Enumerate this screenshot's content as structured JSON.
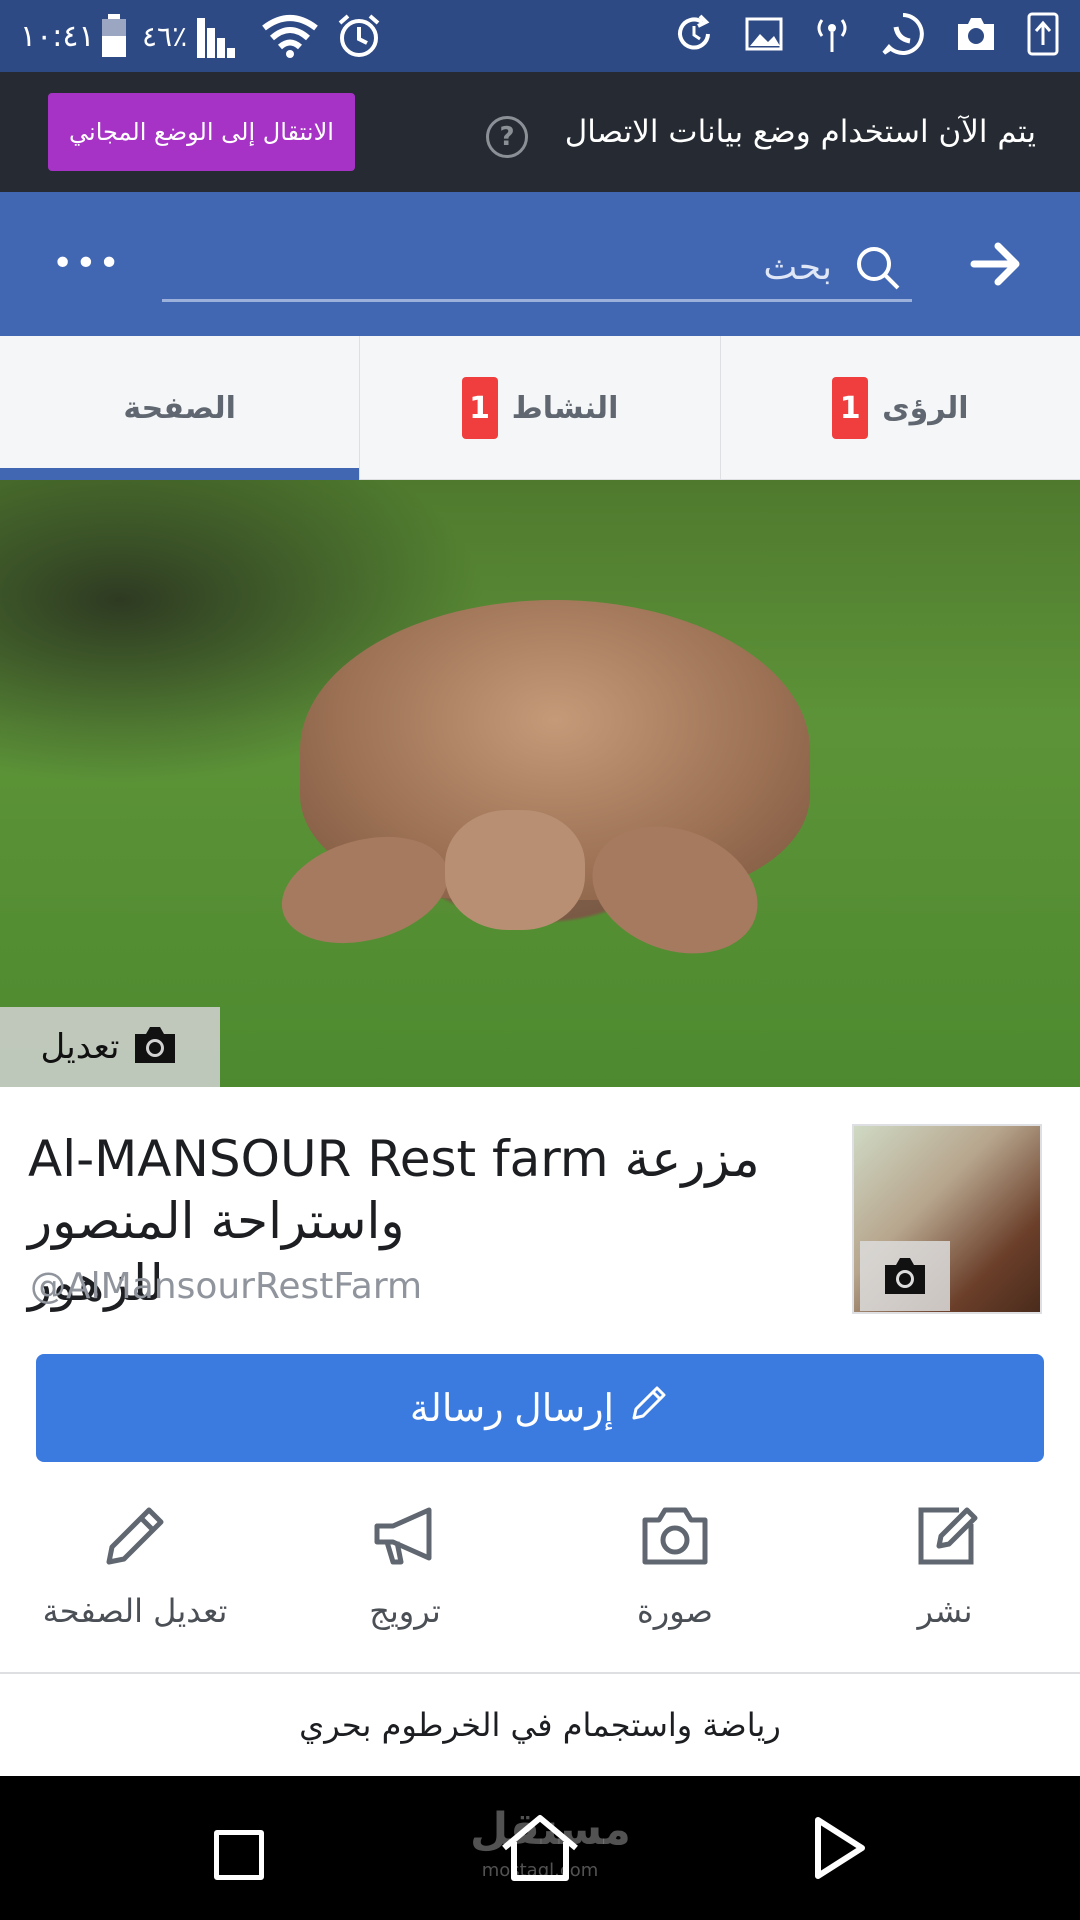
{
  "status_bar": {
    "time": "١٠:٤١",
    "battery_percent": "٤٦٪",
    "icons": [
      "battery-icon",
      "signal-icon",
      "wifi-icon",
      "alarm-icon",
      "sync-icon",
      "image-icon",
      "hotspot-icon",
      "whatsapp-icon",
      "camera-icon",
      "upload-icon"
    ]
  },
  "data_saver": {
    "notice": "يتم الآن استخدام وضع بيانات الاتصال",
    "help": "?",
    "free_mode_button": "الانتقال إلى الوضع المجاني"
  },
  "header": {
    "search_placeholder": "بحث",
    "more": "•••"
  },
  "tabs": [
    {
      "label": "الرؤى",
      "badge": "1"
    },
    {
      "label": "النشاط",
      "badge": "1"
    },
    {
      "label": "الصفحة",
      "active": true
    }
  ],
  "cover": {
    "edit_label": "تعديل"
  },
  "page": {
    "name_line1": "Al-MANSOUR Rest farm مزرعة",
    "name_line2": "واستراحة المنصور للزهور",
    "handle": "@AlMansourRestFarm"
  },
  "send_message_button": "إرسال رسالة",
  "actions": [
    {
      "label": "نشر",
      "icon": "compose-icon"
    },
    {
      "label": "صورة",
      "icon": "camera-icon"
    },
    {
      "label": "ترويج",
      "icon": "megaphone-icon"
    },
    {
      "label": "تعديل الصفحة",
      "icon": "pencil-icon"
    }
  ],
  "category": "رياضة واستجمام في الخرطوم بحري",
  "watermark": {
    "brand": "مستقل",
    "domain": "mostaql.com"
  },
  "colors": {
    "status_bar": "#2e4a85",
    "header": "#4267b2",
    "data_bar": "#262b33",
    "free_mode": "#a733c6",
    "send_button": "#3b7be0",
    "badge": "#f03d3d"
  }
}
